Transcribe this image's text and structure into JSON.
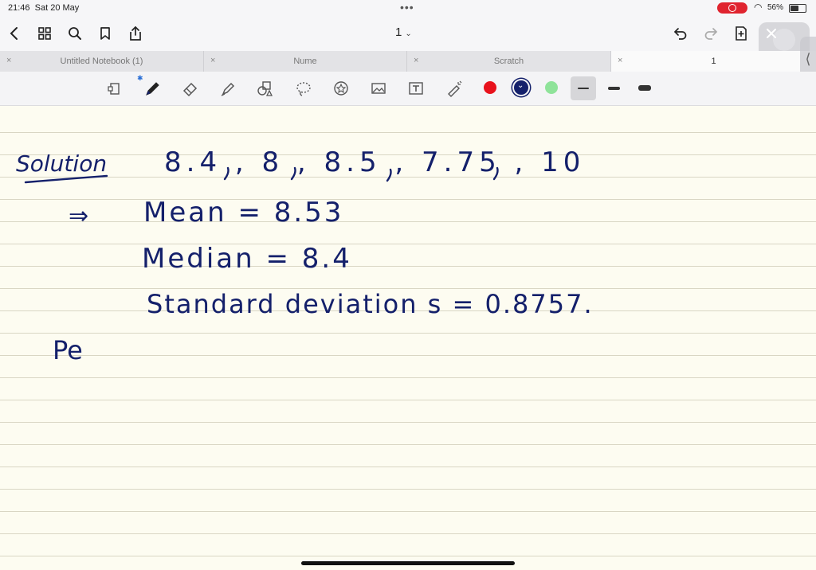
{
  "status": {
    "time": "21:46",
    "date": "Sat 20 May",
    "battery": "56%",
    "battery_level": 0.56
  },
  "nav": {
    "page_label": "1"
  },
  "tabs": [
    {
      "label": "Untitled Notebook (1)"
    },
    {
      "label": "Nume"
    },
    {
      "label": "Scratch"
    },
    {
      "label": "1"
    }
  ],
  "icons": {
    "back": "chevron-left-icon",
    "grid": "grid-icon",
    "search": "search-icon",
    "bookmark": "bookmark-icon",
    "share": "share-icon",
    "undo": "undo-icon",
    "redo": "redo-icon",
    "add_page": "add-page-icon",
    "close": "close-icon"
  },
  "tools": [
    "page-select-tool",
    "pen-tool",
    "eraser-tool",
    "highlighter-tool",
    "shapes-tool",
    "lasso-tool",
    "sticker-tool",
    "image-tool",
    "text-tool",
    "laser-pointer-tool"
  ],
  "colors": {
    "red": "#e8121c",
    "navy": "#14206b",
    "green": "#8fe39a",
    "ink": "#14206b"
  },
  "notes": {
    "solution": "Solution",
    "values": "8.4 , 8 , 8.5 , 7.75 , 10",
    "implies": "⇒",
    "mean": "Mean = 8.53",
    "median": "Median = 8.4",
    "std": "Standard deviation  s = 0.8757.",
    "partial": "Pe"
  }
}
